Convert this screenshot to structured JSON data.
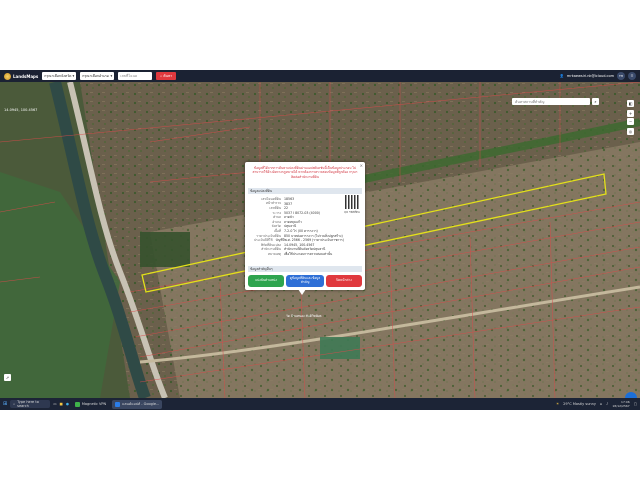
{
  "app": {
    "title": "LandsMaps"
  },
  "toolbar": {
    "province_select": "กรุณาเลือกจังหวัด",
    "district_select": "กรุณาเลือกอำเภอ",
    "parcel_input": "เลขที่โฉนด",
    "search_button": "ค้นหา",
    "user_email": "mrkaewsiri.nk@icloud.com",
    "lang": "TH"
  },
  "map": {
    "search_placeholder": "ค้นหาสถานที่สำคัญ",
    "coordinate": "14.0945, 100.4567",
    "pin_label": "วัด บ้านหนอง สันติวิทย์ผล",
    "colors": {
      "parcel_outline": "#e3e01a",
      "boundary": "#d94a4a"
    }
  },
  "popup": {
    "notice": "ข้อมูลที่ได้จากการค้นหาแปลงที่ดินผ่านแอปพลิเคชันนี้เป็นข้อมูลประกอบ ไม่สามารถใช้อ้างอิงทางกฎหมายได้ หากต้องการตรวจสอบข้อมูลที่ถูกต้อง กรุณาติดต่อสำนักงานที่ดิน",
    "section_title": "ข้อมูลแปลงที่ดิน",
    "rows": [
      {
        "key": "เลขโฉนดที่ดิน",
        "value": "18563"
      },
      {
        "key": "หน้าสำรวจ",
        "value": "3837"
      },
      {
        "key": "เลขที่ดิน",
        "value": "22"
      },
      {
        "key": "ระวาง",
        "value": "5037 I 8072-03 (4000)"
      },
      {
        "key": "ตำบล",
        "value": "ลาดบัว"
      },
      {
        "key": "อำเภอ",
        "value": "ลาดหลุมแก้ว"
      },
      {
        "key": "จังหวัด",
        "value": "ปทุมธานี"
      },
      {
        "key": "เนื้อที่",
        "value": "7-2-0 ไร่ (00 ตารางวา)"
      },
      {
        "key": "ราคาประเมินที่ดิน",
        "value": "850 บาทต่อตารางวา (ไม่รวมสิ่งปลูกสร้าง)"
      },
      {
        "key": "ประเมินปีที่ใช้",
        "value": "บัญชีปีพ.ศ. 2566 - 2569 (ราคาประเมินราชการ)"
      },
      {
        "key": "พิกัดที่ดินแปลง",
        "value": "14.0945, 100.4567"
      },
      {
        "key": "สำนักงานที่ดิน",
        "value": "สำนักงานที่ดินจังหวัดปทุมธานี"
      },
      {
        "key": "หมายเหตุ",
        "value": "เพื่อใช้ประกอบการตรวจสอบเท่านั้น"
      }
    ],
    "qr_label": "QR รหัสที่ดิน",
    "section2_title": "ข้อมูลสำคัญอื่นๆ",
    "buttons": {
      "share": "แบ่งปันตำแหน่ง",
      "details": "ดูข้อมูลที่ดินและข้อมูลสำคัญ",
      "close": "ปิดหน้าต่าง"
    },
    "button_colors": {
      "share": "#2ea44f",
      "details": "#2f6fd6",
      "close": "#e0393e"
    }
  },
  "taskbar": {
    "search": "Type here to search",
    "apps": [
      {
        "label": "Magnetic VPN",
        "color": "#3fb24a"
      },
      {
        "label": "แลนด์แมปส์ - Google...",
        "color": "#2b7de9"
      }
    ],
    "weather": "29°C Mostly sunny",
    "time": "17:06",
    "date": "18/12/2567"
  }
}
